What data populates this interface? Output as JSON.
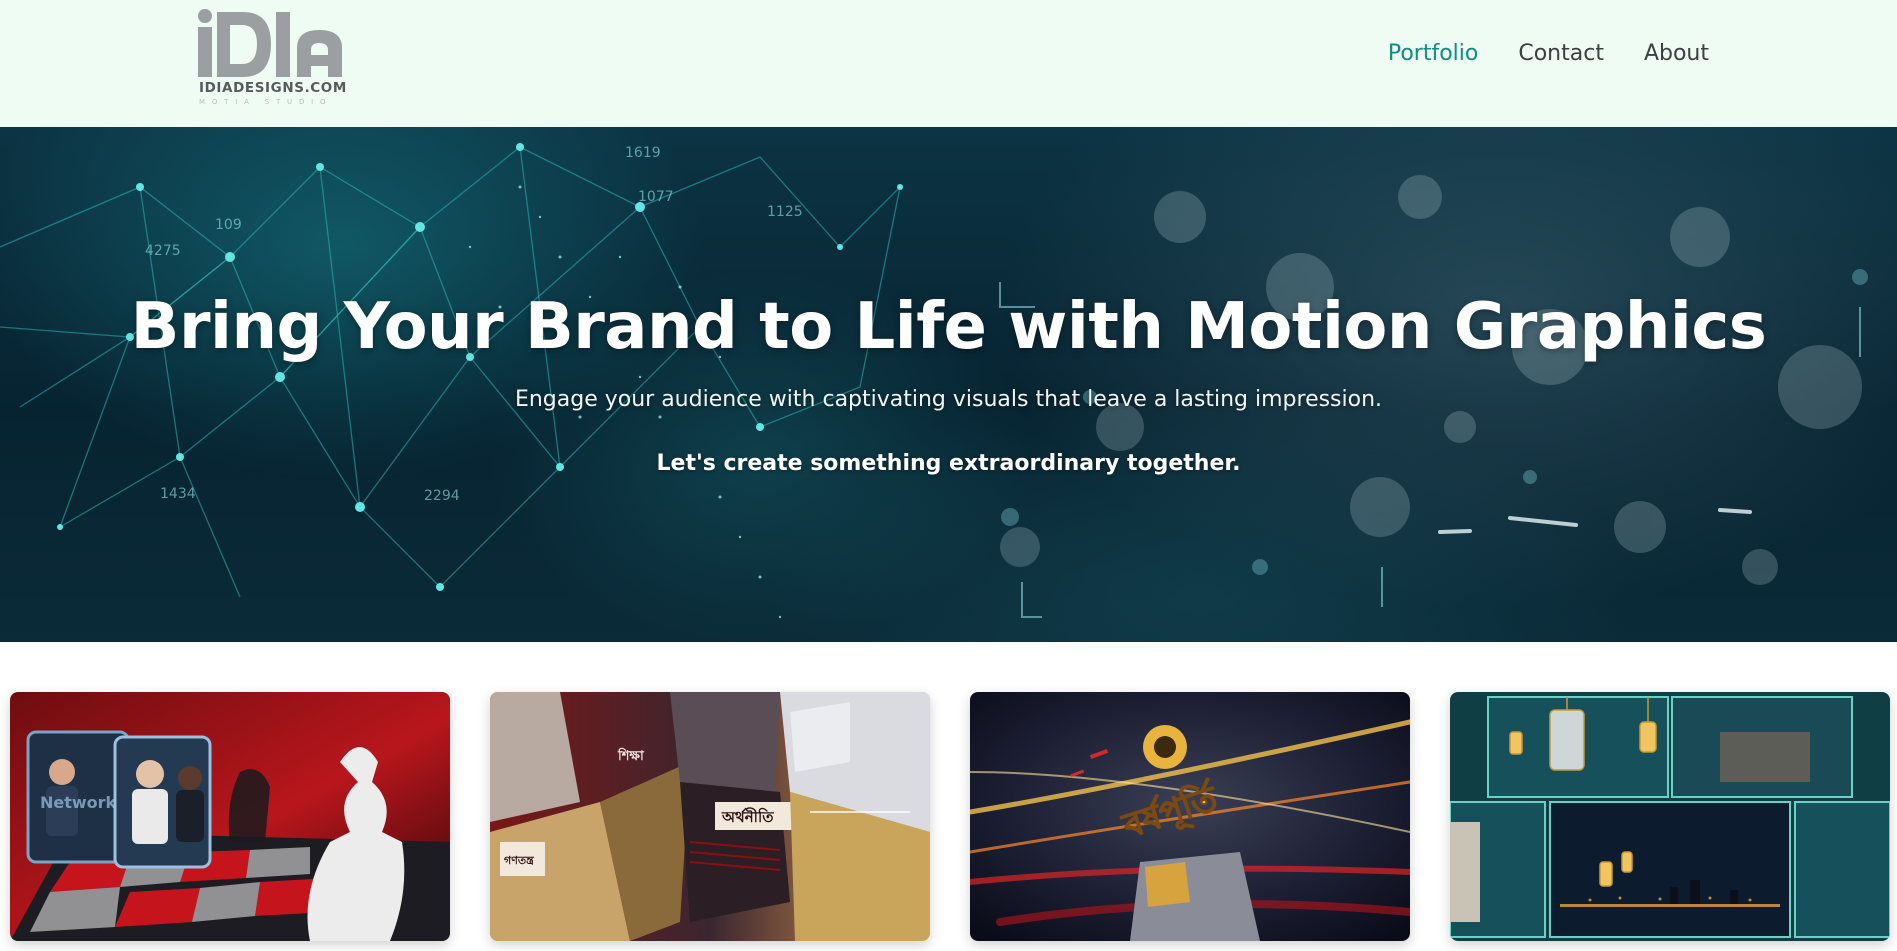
{
  "brand": {
    "logo_mark": "iDIA",
    "logo_text": "IDIADESIGNS.COM",
    "logo_sub": "MOTIA STUDIO"
  },
  "nav": {
    "items": [
      {
        "label": "Portfolio",
        "active": true
      },
      {
        "label": "Contact",
        "active": false
      },
      {
        "label": "About",
        "active": false
      }
    ]
  },
  "hero": {
    "title": "Bring Your Brand to Life with Motion Graphics",
    "subtitle": "Engage your audience with captivating visuals that leave a lasting impression.",
    "cta": "Let's create something extraordinary together.",
    "bg_numbers": [
      "1619",
      "1077",
      "1125",
      "4275",
      "109",
      "2294",
      "1434"
    ]
  },
  "portfolio": {
    "items": [
      {
        "thumbnail": "news-studio-chess-thumbnail",
        "caption": "Network"
      },
      {
        "thumbnail": "news-cubes-thumbnail",
        "caption": "অর্থনীতি",
        "extra": [
          "গণতন্ত্র",
          "শিক্ষা"
        ]
      },
      {
        "thumbnail": "golden-title-thumbnail",
        "caption": "বর্ষপূর্তি"
      },
      {
        "thumbnail": "ramadan-lanterns-thumbnail",
        "caption": ""
      }
    ]
  },
  "colors": {
    "header_bg": "#effcf3",
    "nav_active": "#0e8f81",
    "nav_text": "#3a3f42",
    "hero_bg": "#0a2430",
    "hero_accent": "#2fc2c4"
  }
}
